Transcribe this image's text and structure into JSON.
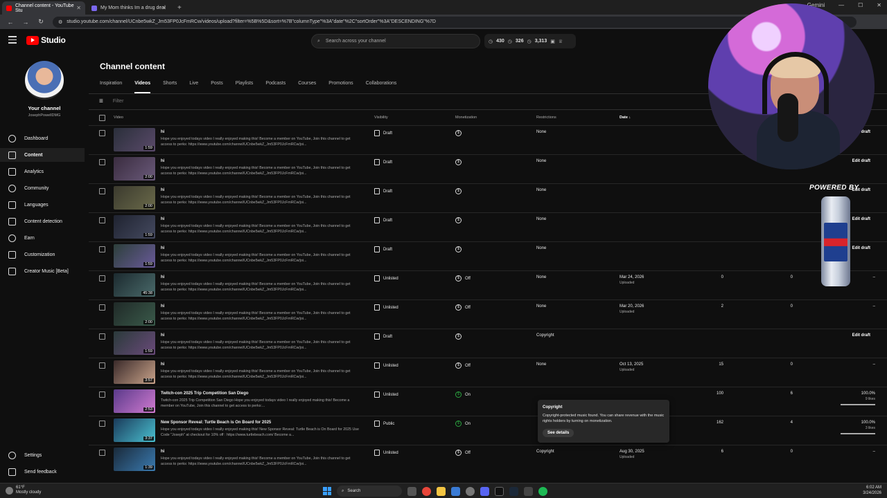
{
  "browser": {
    "tabs": [
      {
        "title": "Channel content - YouTube Stu",
        "color": "#ff0000"
      },
      {
        "title": "My Mom thinks Im a drug deal",
        "color": "#7b68ee"
      }
    ],
    "new_tab": "+",
    "url": "studio.youtube.com/channel/UCnbe5wkZ_Jm53FP0JcFmRCw/videos/upload?filter=%5B%5D&sort=%7B\"columnType\"%3A\"date\"%2C\"sortOrder\"%3A\"DESCENDING\"%7D",
    "profile_label": "Gemini"
  },
  "header": {
    "logo_text": "Studio",
    "search_placeholder": "Search across your channel",
    "stats": {
      "a": "430",
      "b": "326",
      "c": "3,313"
    }
  },
  "sidebar": {
    "channel_title": "Your channel",
    "channel_handle": "JosephPowellDMG",
    "items": [
      {
        "label": "Dashboard",
        "icon": "dashboard-icon",
        "active": false
      },
      {
        "label": "Content",
        "icon": "content-icon",
        "active": true
      },
      {
        "label": "Analytics",
        "icon": "analytics-icon",
        "active": false
      },
      {
        "label": "Community",
        "icon": "community-icon",
        "active": false
      },
      {
        "label": "Languages",
        "icon": "languages-icon",
        "active": false
      },
      {
        "label": "Content detection",
        "icon": "content-detection-icon",
        "active": false
      },
      {
        "label": "Earn",
        "icon": "earn-icon",
        "active": false
      },
      {
        "label": "Customization",
        "icon": "customization-icon",
        "active": false
      },
      {
        "label": "Creator Music [Beta]",
        "icon": "creator-music-icon",
        "active": false
      }
    ],
    "settings": "Settings",
    "feedback": "Send feedback"
  },
  "main": {
    "title": "Channel content",
    "tabs": [
      "Inspiration",
      "Videos",
      "Shorts",
      "Live",
      "Posts",
      "Playlists",
      "Podcasts",
      "Courses",
      "Promotions",
      "Collaborations"
    ],
    "active_tab": "Videos",
    "filter_placeholder": "Filter",
    "columns": {
      "video": "Video",
      "visibility": "Visibility",
      "monetization": "Monetization",
      "restrictions": "Restrictions",
      "date": "Date"
    }
  },
  "rows": [
    {
      "title": "hi",
      "desc": "Hope you enjoyed todays video I really enjoyed making this! Become a member on YouTube, Join this channel to get access to perks: https://www.youtube.com/channel/UCnbe5wkZ_Jm53FP0JcFmRCw/joi...",
      "duration": "1:59",
      "visibility": "Draft",
      "monetization": "",
      "restrictions": "None",
      "date": "",
      "date_sub": "",
      "views": "",
      "comments": "",
      "likes": "",
      "likes_sub": "",
      "like_ratio": 0,
      "action": "Edit draft"
    },
    {
      "title": "hi",
      "desc": "Hope you enjoyed todays video I really enjoyed making this! Become a member on YouTube, Join this channel to get access to perks: https://www.youtube.com/channel/UCnbe5wkZ_Jm53FP0JcFmRCw/joi...",
      "duration": "2:00",
      "visibility": "Draft",
      "monetization": "",
      "restrictions": "None",
      "date": "",
      "date_sub": "",
      "views": "",
      "comments": "",
      "likes": "",
      "likes_sub": "",
      "like_ratio": 0,
      "action": "Edit draft"
    },
    {
      "title": "hi",
      "desc": "Hope you enjoyed todays video I really enjoyed making this! Become a member on YouTube, Join this channel to get access to perks: https://www.youtube.com/channel/UCnbe5wkZ_Jm53FP0JcFmRCw/joi...",
      "duration": "2:00",
      "visibility": "Draft",
      "monetization": "",
      "restrictions": "None",
      "date": "",
      "date_sub": "",
      "views": "",
      "comments": "",
      "likes": "",
      "likes_sub": "",
      "like_ratio": 0,
      "action": "Edit draft"
    },
    {
      "title": "hi",
      "desc": "Hope you enjoyed todays video I really enjoyed making this! Become a member on YouTube, Join this channel to get access to perks: https://www.youtube.com/channel/UCnbe5wkZ_Jm53FP0JcFmRCw/joi...",
      "duration": "1:59",
      "visibility": "Draft",
      "monetization": "",
      "restrictions": "None",
      "date": "",
      "date_sub": "",
      "views": "",
      "comments": "",
      "likes": "",
      "likes_sub": "",
      "like_ratio": 0,
      "action": "Edit draft"
    },
    {
      "title": "hi",
      "desc": "Hope you enjoyed todays video I really enjoyed making this! Become a member on YouTube, Join this channel to get access to perks: https://www.youtube.com/channel/UCnbe5wkZ_Jm53FP0JcFmRCw/joi...",
      "duration": "1:59",
      "visibility": "Draft",
      "monetization": "",
      "restrictions": "None",
      "date": "",
      "date_sub": "",
      "views": "",
      "comments": "",
      "likes": "",
      "likes_sub": "",
      "like_ratio": 0,
      "action": "Edit draft"
    },
    {
      "title": "hi",
      "desc": "Hope you enjoyed todays video I really enjoyed making this! Become a member on YouTube, Join this channel to get access to perks: https://www.youtube.com/channel/UCnbe5wkZ_Jm53FP0JcFmRCw/joi...",
      "duration": "45:38",
      "visibility": "Unlisted",
      "monetization": "Off",
      "restrictions": "None",
      "date": "Mar 24, 2026",
      "date_sub": "Uploaded",
      "views": "0",
      "comments": "0",
      "likes": "–",
      "likes_sub": "",
      "like_ratio": 0,
      "action": ""
    },
    {
      "title": "hi",
      "desc": "Hope you enjoyed todays video I really enjoyed making this! Become a member on YouTube, Join this channel to get access to perks: https://www.youtube.com/channel/UCnbe5wkZ_Jm53FP0JcFmRCw/joi...",
      "duration": "2:00",
      "visibility": "Unlisted",
      "monetization": "Off",
      "restrictions": "None",
      "date": "Mar 20, 2026",
      "date_sub": "Uploaded",
      "views": "2",
      "comments": "0",
      "likes": "–",
      "likes_sub": "",
      "like_ratio": 0,
      "action": ""
    },
    {
      "title": "hi",
      "desc": "Hope you enjoyed todays video I really enjoyed making this! Become a member on YouTube, Join this channel to get access to perks: https://www.youtube.com/channel/UCnbe5wkZ_Jm53FP0JcFmRCw/joi...",
      "duration": "1:59",
      "visibility": "Draft",
      "monetization": "",
      "restrictions": "Copyright",
      "date": "",
      "date_sub": "",
      "views": "",
      "comments": "",
      "likes": "",
      "likes_sub": "",
      "like_ratio": 0,
      "action": "Edit draft"
    },
    {
      "title": "hi",
      "desc": "Hope you enjoyed todays video I really enjoyed making this! Become a member on YouTube, Join this channel to get access to perks: https://www.youtube.com/channel/UCnbe5wkZ_Jm53FP0JcFmRCw/joi...",
      "duration": "3:57",
      "visibility": "Unlisted",
      "monetization": "Off",
      "restrictions": "None",
      "date": "Oct 13, 2025",
      "date_sub": "Uploaded",
      "views": "15",
      "comments": "0",
      "likes": "–",
      "likes_sub": "",
      "like_ratio": 0,
      "action": ""
    },
    {
      "title": "Twitch-con 2025 Trip Competition San Diego",
      "desc": "Twitch-con 2025 Trip Competition San Diego Hope you enjoyed todays video I really enjoyed making this! Become a member on YouTube, Join this channel to get access to perks:...",
      "duration": "2:53",
      "visibility": "Unlisted",
      "monetization": "On",
      "restrictions": "",
      "date": "",
      "date_sub": "",
      "views": "100",
      "comments": "6",
      "likes": "100.0%",
      "likes_sub": "9 likes",
      "like_ratio": 1,
      "action": ""
    },
    {
      "title": "New Sponsor Reveal: Turtle Beach is On Board for 2025",
      "desc": "Hope you enjoyed todays video I really enjoyed making this! New Sponsor Reveal: Turtle Beach is On Board for 2025 Use Code \"Joseph\" at checkout for 10% off : https://www.turtlebeach.com/ Become a...",
      "duration": "3:37",
      "visibility": "Public",
      "monetization": "On",
      "restrictions": "",
      "date": "",
      "date_sub": "",
      "views": "162",
      "comments": "4",
      "likes": "100.0%",
      "likes_sub": "3 likes",
      "like_ratio": 1,
      "action": ""
    },
    {
      "title": "hi",
      "desc": "Hope you enjoyed todays video I really enjoyed making this! Become a member on YouTube, Join this channel to get access to perks: https://www.youtube.com/channel/UCnbe5wkZ_Jm53FP0JcFmRCw/joi...",
      "duration": "1:39",
      "visibility": "Unlisted",
      "monetization": "Off",
      "restrictions": "Copyright",
      "date": "Aug 30, 2025",
      "date_sub": "Uploaded",
      "views": "6",
      "comments": "0",
      "likes": "–",
      "likes_sub": "",
      "like_ratio": 0,
      "action": ""
    }
  ],
  "tooltip": {
    "title": "Copyright",
    "body": "Copyright-protected music found. You can share revenue with the music rights holders by turning on monetization.",
    "button": "See details"
  },
  "overlay": {
    "powered_by": "POWERED BY"
  },
  "taskbar": {
    "weather_temp": "61°F",
    "weather_desc": "Mostly cloudy",
    "search": "Search",
    "time": "6:02 AM",
    "date": "3/24/2026"
  }
}
